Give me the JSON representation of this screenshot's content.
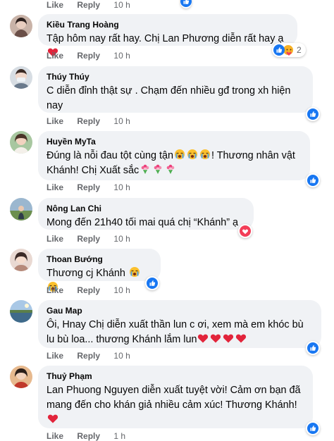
{
  "actions": {
    "like": "Like",
    "reply": "Reply"
  },
  "top_partial": {
    "time": "10 h"
  },
  "comments": [
    {
      "name": "Kiều Trang Hoàng",
      "text": "Tập hôm nay rất hay. Chị Lan Phương diễn rất hay ạ",
      "time": "10 h",
      "reactions": [
        "like",
        "care"
      ],
      "count": "2"
    },
    {
      "name": "Thúy Thúy",
      "lines": [
        "C diễn đỉnh thật sự . Chạm đến nhiều gđ trong xh hiện",
        "nay"
      ],
      "time": "10 h",
      "reactions": [
        "like"
      ]
    },
    {
      "name": "Huyền MyTa",
      "lines": [
        "Đúng là nỗi đau tột cùng tận",
        "! Thương nhân vật",
        "Khánh! Chị Xuất sắc"
      ],
      "time": "10 h",
      "reactions": [
        "like"
      ]
    },
    {
      "name": "Nông Lan Chi",
      "text": "Mong đến 21h40 tối mai quá chị “Khánh” ạ",
      "time": "10 h",
      "reactions": [
        "love"
      ]
    },
    {
      "name": "Thoan Bướng",
      "text": "Thương cj Khánh",
      "time": "10 h",
      "reactions": [
        "like"
      ]
    },
    {
      "name": "Gau Map",
      "lines": [
        "Ôi, Hnay Chị diễn xuất thần lun c ơi, xem mà em khóc bù",
        "lu bù loa... thương Khánh lắm lun"
      ],
      "time": "10 h",
      "reactions": [
        "like"
      ]
    },
    {
      "name": "Thuỷ Phạm",
      "lines": [
        "Lan Phuong Nguyen diễn xuất tuyệt vời! Cảm ơn bạn đã",
        "mang đến cho khán giả nhiều cảm xúc! Thương Khánh!"
      ],
      "time": "1 h",
      "reactions": [
        "like"
      ]
    }
  ],
  "colors": {
    "like_blue": "#1877f2",
    "love_red": "#f33e58",
    "bubble_bg": "#f0f2f5",
    "meta_gray": "#65676b"
  }
}
